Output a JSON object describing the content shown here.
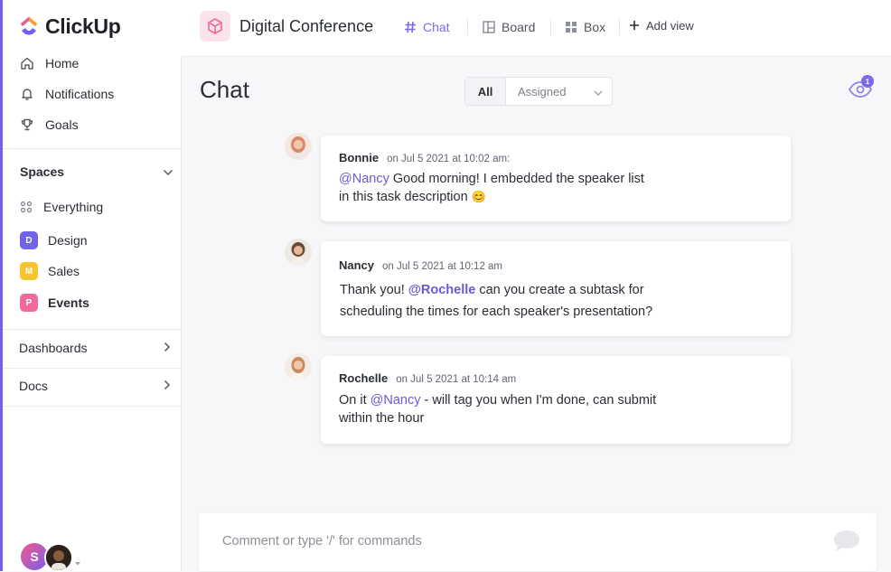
{
  "app": {
    "logo_text": "ClickUp"
  },
  "sidebar": {
    "nav": [
      {
        "label": "Home",
        "icon": "home-icon"
      },
      {
        "label": "Notifications",
        "icon": "bell-icon"
      },
      {
        "label": "Goals",
        "icon": "trophy-icon"
      }
    ],
    "spaces_label": "Spaces",
    "spaces": [
      {
        "label": "Everything",
        "icon": "grid-dots-icon"
      },
      {
        "label": "Design",
        "badge": "D",
        "color": "#6f63e6"
      },
      {
        "label": "Sales",
        "badge": "M",
        "color": "#f7c52a"
      },
      {
        "label": "Events",
        "badge": "P",
        "color": "#f06a9c",
        "active": true
      }
    ],
    "dashboards_label": "Dashboards",
    "docs_label": "Docs",
    "user_initial": "S"
  },
  "header": {
    "project_title": "Digital Conference",
    "views": [
      {
        "label": "Chat",
        "icon": "hash-icon",
        "active": true
      },
      {
        "label": "Board",
        "icon": "board-icon"
      },
      {
        "label": "Box",
        "icon": "box-grid-icon"
      },
      {
        "label": "Add view",
        "icon": "plus-icon"
      }
    ]
  },
  "chat": {
    "title": "Chat",
    "filters": {
      "all": "All",
      "assigned": "Assigned"
    },
    "watchers_count": "1",
    "messages": [
      {
        "author": "Bonnie",
        "time": "on Jul 5 2021 at 10:02 am:",
        "mention": "@Nancy",
        "text_line1": " Good morning! I embedded the speaker list",
        "text_line2": "in this task description ",
        "emoji": "😊"
      },
      {
        "author": "Nancy",
        "time": "on Jul 5 2021 at 10:12 am",
        "prefix": "Thank you! ",
        "mention": "@Rochelle",
        "text_line1": " can you create a subtask for",
        "text_line2": "scheduling the times for each speaker's presentation?"
      },
      {
        "author": "Rochelle",
        "time": "on Jul 5 2021 at 10:14 am",
        "prefix": "On it ",
        "mention": "@Nancy",
        "text_line1": " - will tag you when I'm done, can submit",
        "text_line2": "within the hour"
      }
    ],
    "comment_placeholder": "Comment or type '/' for commands"
  }
}
